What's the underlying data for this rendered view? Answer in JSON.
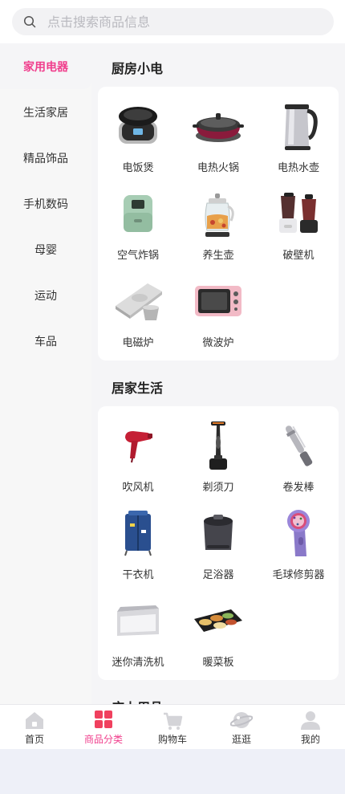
{
  "search": {
    "placeholder": "点击搜索商品信息"
  },
  "sidebar": {
    "items": [
      {
        "label": "家用电器"
      },
      {
        "label": "生活家居"
      },
      {
        "label": "精品饰品"
      },
      {
        "label": "手机数码"
      },
      {
        "label": "母婴"
      },
      {
        "label": "运动"
      },
      {
        "label": "车品"
      }
    ],
    "active_index": 0
  },
  "sections": [
    {
      "title": "厨房小电",
      "items": [
        {
          "label": "电饭煲",
          "icon": "rice-cooker-icon"
        },
        {
          "label": "电热火锅",
          "icon": "hot-pot-icon"
        },
        {
          "label": "电热水壶",
          "icon": "kettle-icon"
        },
        {
          "label": "空气炸锅",
          "icon": "air-fryer-icon"
        },
        {
          "label": "养生壶",
          "icon": "health-pot-icon"
        },
        {
          "label": "破壁机",
          "icon": "blender-icon"
        },
        {
          "label": "电磁炉",
          "icon": "induction-cooker-icon"
        },
        {
          "label": "微波炉",
          "icon": "microwave-icon"
        }
      ]
    },
    {
      "title": "居家生活",
      "items": [
        {
          "label": "吹风机",
          "icon": "hair-dryer-icon"
        },
        {
          "label": "剃须刀",
          "icon": "shaver-icon"
        },
        {
          "label": "卷发棒",
          "icon": "curling-iron-icon"
        },
        {
          "label": "干衣机",
          "icon": "clothes-dryer-icon"
        },
        {
          "label": "足浴器",
          "icon": "foot-bath-icon"
        },
        {
          "label": "毛球修剪器",
          "icon": "lint-remover-icon"
        },
        {
          "label": "迷你清洗机",
          "icon": "mini-washer-icon"
        },
        {
          "label": "暖菜板",
          "icon": "food-warmer-icon"
        }
      ]
    },
    {
      "title": "床上用品"
    }
  ],
  "tabbar": {
    "items": [
      {
        "label": "首页",
        "icon": "home-icon"
      },
      {
        "label": "商品分类",
        "icon": "category-icon"
      },
      {
        "label": "购物车",
        "icon": "cart-icon"
      },
      {
        "label": "逛逛",
        "icon": "planet-icon"
      },
      {
        "label": "我的",
        "icon": "user-icon"
      }
    ],
    "active_index": 1
  },
  "colors": {
    "accent": "#f03e8c",
    "background": "#f5f5f7",
    "card": "#ffffff",
    "below_page": "#eef0f8"
  }
}
